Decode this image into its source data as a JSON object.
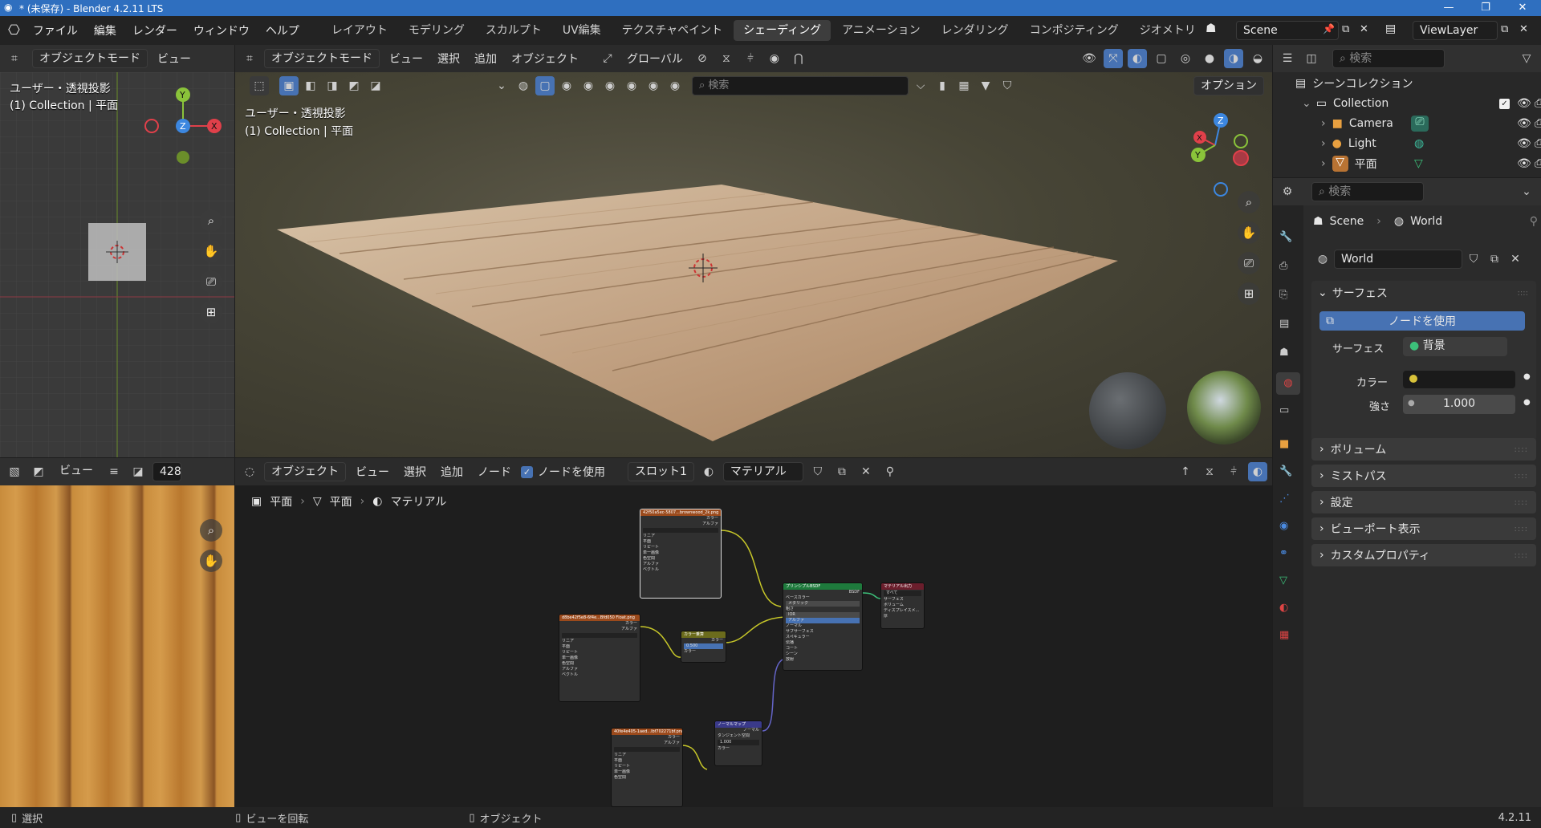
{
  "titlebar": {
    "title": "* (未保存) - Blender 4.2.11 LTS",
    "min": "—",
    "max": "❐",
    "close": "✕"
  },
  "menu": [
    "ファイル",
    "編集",
    "レンダー",
    "ウィンドウ",
    "ヘルプ"
  ],
  "workspaces": [
    "レイアウト",
    "モデリング",
    "スカルプト",
    "UV編集",
    "テクスチャペイント",
    "シェーディング",
    "アニメーション",
    "レンダリング",
    "コンポジティング",
    "ジオメトリ"
  ],
  "active_workspace_index": 5,
  "scene": {
    "label": "Scene",
    "viewlayer": "ViewLayer"
  },
  "left_viewport": {
    "mode": "オブジェクトモード",
    "view_menu": "ビュー",
    "overlay_line1": "ユーザー・透視投影",
    "overlay_line2": "(1) Collection | 平面"
  },
  "main_viewport": {
    "mode": "オブジェクトモード",
    "menus": [
      "ビュー",
      "選択",
      "追加",
      "オブジェクト"
    ],
    "transform": "グローバル",
    "search_placeholder": "検索",
    "options": "オプション",
    "overlay_line1": "ユーザー・透視投影",
    "overlay_line2": "(1) Collection | 平面"
  },
  "image_editor": {
    "view_menu": "ビュー",
    "image_name": "428("
  },
  "node_editor": {
    "editor_type": "オブジェクト",
    "menus": [
      "ビュー",
      "選択",
      "追加",
      "ノード"
    ],
    "use_nodes_label": "ノードを使用",
    "slot": "スロット1",
    "material": "マテリアル",
    "breadcrumb": [
      "平面",
      "平面",
      "マテリアル"
    ],
    "nodes": {
      "tex1": "42f50a5ec-5807...brownwood_2k.png",
      "tex2": "d8be42f5e8-6f4e...Bfd050 Float.png",
      "tex3": "40fe4e405-1aed...lbf702271bf.png",
      "color_ramp": "カラー乗算",
      "bsdf": "プリンシプルBSDF",
      "output": "マテリアル出力",
      "normal_map": "ノーマルマップ",
      "socket_color": "カラー",
      "socket_alpha": "アルファ",
      "tex_rows": [
        "リニア",
        "平面",
        "リピート",
        "単一画像",
        "色空間",
        "sRGB",
        "アルファ",
        "ストレート",
        "ベクトル"
      ],
      "bsdf_rows": [
        "ベースカラー",
        "メタリック",
        "粗さ",
        "IOR",
        "アルファ",
        "ノーマル",
        "サブサーフェス",
        "スペキュラー",
        "伝播",
        "コート",
        "シーン",
        "放射",
        "薄膜"
      ],
      "bsdf_values": [
        "0.000",
        "0.500",
        "1.500",
        "1.000"
      ],
      "output_rows": [
        "すべて",
        "サーフェス",
        "ボリューム",
        "ディスプレイスメ...",
        "厚"
      ],
      "normal_rows": [
        "ノーマル",
        "タンジェント空間",
        "強さ",
        "カラー"
      ],
      "normal_strength": "1.000",
      "ramp_value": "0.500"
    }
  },
  "outliner": {
    "search_placeholder": "検索",
    "scene_collection": "シーンコレクション",
    "items": [
      {
        "name": "Collection",
        "icon": "collection-icon"
      },
      {
        "name": "Camera",
        "icon": "camera-icon"
      },
      {
        "name": "Light",
        "icon": "light-icon"
      },
      {
        "name": "平面",
        "icon": "mesh-icon"
      }
    ]
  },
  "properties": {
    "search_placeholder": "検索",
    "breadcrumb_scene": "Scene",
    "breadcrumb_world": "World",
    "world_name": "World",
    "surface_panel": "サーフェス",
    "use_nodes_button": "ノードを使用",
    "surface_label": "サーフェス",
    "surface_value": "背景",
    "color_label": "カラー",
    "strength_label": "強さ",
    "strength_value": "1.000",
    "panels": [
      "ボリューム",
      "ミストパス",
      "設定",
      "ビューポート表示",
      "カスタムプロパティ"
    ]
  },
  "statusbar": {
    "select": "選択",
    "rotate": "ビューを回転",
    "object": "オブジェクト",
    "version": "4.2.11"
  },
  "colors": {
    "accent": "#4772b3",
    "x_axis": "#e0404a",
    "y_axis": "#8ac33a",
    "z_axis": "#3c87e0",
    "titlebar": "#2f6fbf"
  }
}
